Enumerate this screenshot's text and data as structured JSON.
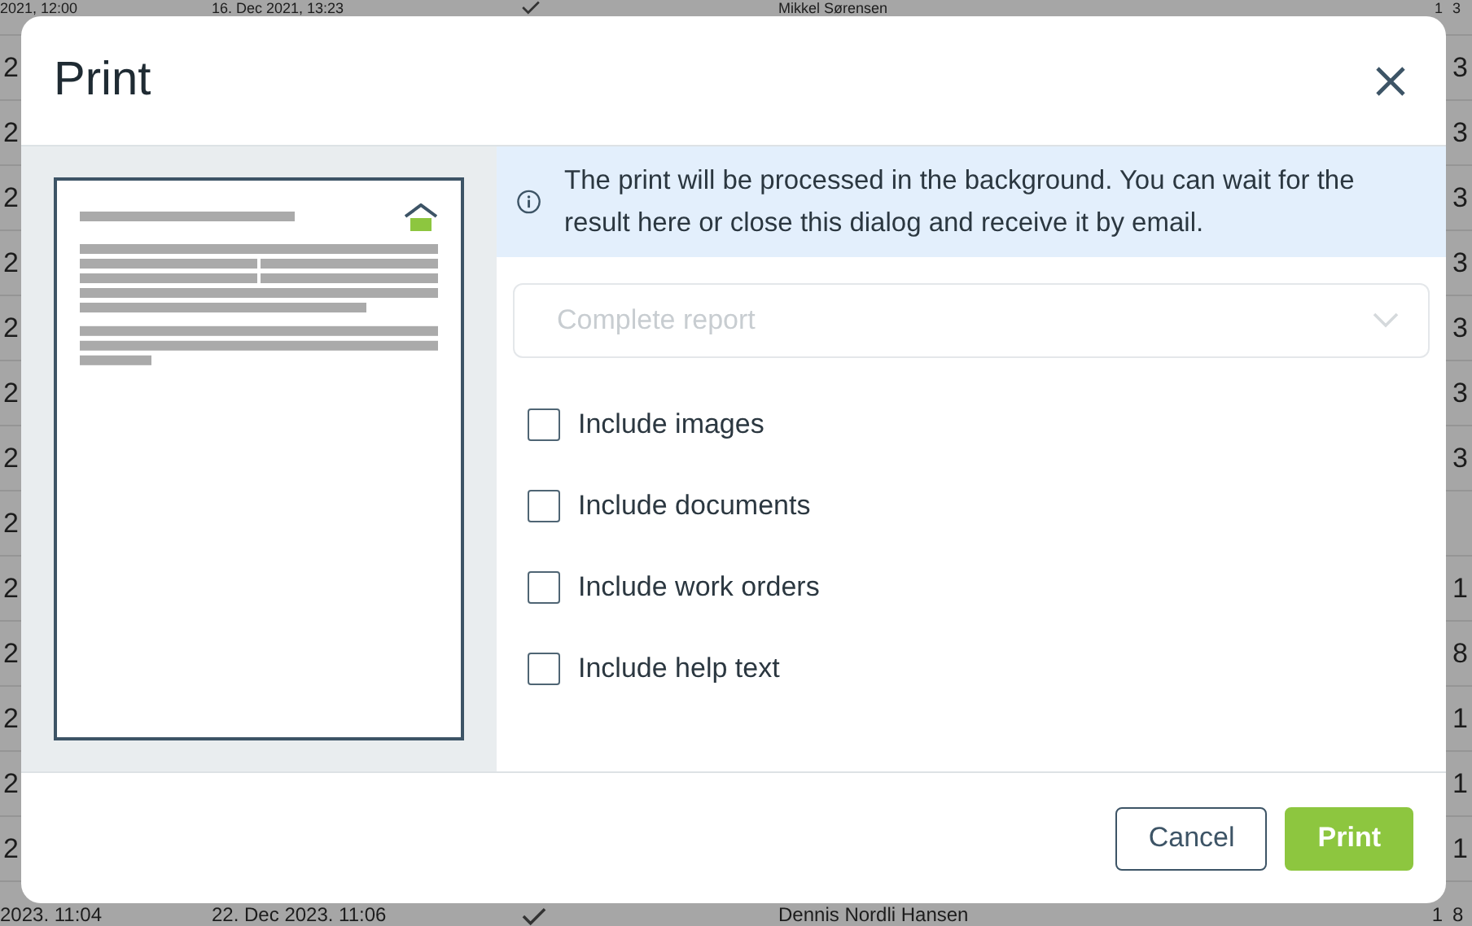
{
  "background_table": {
    "rows": [
      {
        "column_1": "2021, 12:00",
        "column_2": "16. Dec 2021, 13:23",
        "checked": true,
        "column_4": "Mikkel Sørensen",
        "column_5": "1",
        "column_6": "3"
      },
      {
        "column_1": "2",
        "column_6": "3"
      },
      {
        "column_1": "2",
        "column_6": "3"
      },
      {
        "column_1": "2",
        "column_6": "3"
      },
      {
        "column_1": "2",
        "column_6": "3"
      },
      {
        "column_1": "2",
        "column_6": "3"
      },
      {
        "column_1": "2",
        "column_6": "3"
      },
      {
        "column_1": "2",
        "column_6": "3"
      },
      {
        "column_1": "2"
      },
      {
        "column_1": "2",
        "column_6": "1"
      },
      {
        "column_1": "2",
        "column_6": "8"
      },
      {
        "column_1": "2",
        "column_6": "1"
      },
      {
        "column_1": "2",
        "column_6": "1"
      },
      {
        "column_1": "2",
        "column_6": "1"
      },
      {
        "column_1": "2023. 11:04",
        "column_2": "22. Dec 2023. 11:06",
        "checked": true,
        "column_4": "Dennis Nordli Hansen",
        "column_5": "1",
        "column_6": "8"
      }
    ]
  },
  "dialog": {
    "title": "Print",
    "info": "The print will be processed in the background. You can wait for the result here or close this dialog and receive it by email.",
    "report_select": {
      "placeholder": "Complete report",
      "disabled": true
    },
    "options": [
      {
        "label": "Include images",
        "checked": false
      },
      {
        "label": "Include documents",
        "checked": false
      },
      {
        "label": "Include work orders",
        "checked": false
      },
      {
        "label": "Include help text",
        "checked": false
      }
    ],
    "buttons": [
      {
        "label": "Cancel",
        "kind": "secondary"
      },
      {
        "label": "Print",
        "kind": "primary"
      }
    ]
  }
}
